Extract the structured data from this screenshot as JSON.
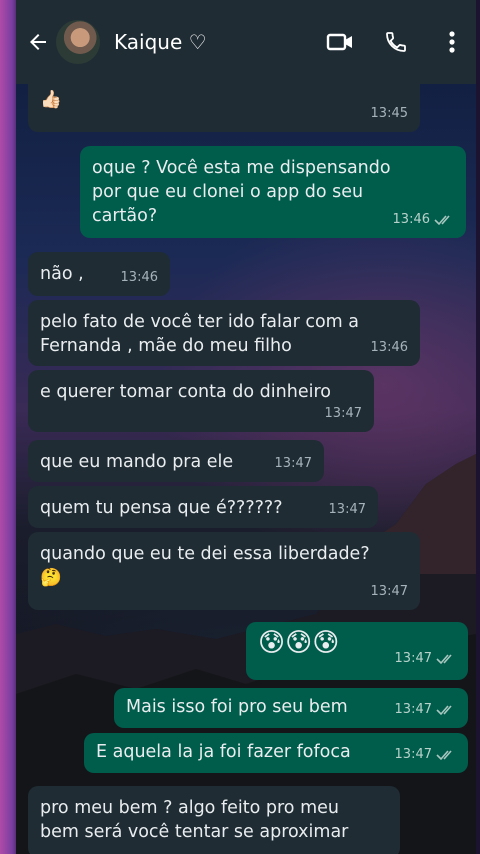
{
  "header": {
    "contact_name": "Kaique ♡"
  },
  "messages": [
    {
      "dir": "in",
      "text": "você , mais enfim nosso namoro acabou 👍🏻",
      "time": "13:45"
    },
    {
      "dir": "out",
      "text": "oque ? Você esta me dispensando por que eu clonei o app do seu cartão?",
      "time": "13:46"
    },
    {
      "dir": "in",
      "text": "não ,",
      "time": "13:46"
    },
    {
      "dir": "in",
      "text": "pelo fato de você ter ido falar com a Fernanda , mãe do meu filho",
      "time": "13:46"
    },
    {
      "dir": "in",
      "text": "e querer tomar conta do dinheiro",
      "time": "13:47"
    },
    {
      "dir": "in",
      "text": "que eu mando pra ele",
      "time": "13:47"
    },
    {
      "dir": "in",
      "text": "quem tu pensa que é??????",
      "time": "13:47"
    },
    {
      "dir": "in",
      "text": "quando que eu te dei essa liberdade? 🤔",
      "time": "13:47"
    },
    {
      "dir": "out",
      "text": "😰😰😰",
      "time": "13:47"
    },
    {
      "dir": "out",
      "text": "Mais isso foi pro seu bem",
      "time": "13:47"
    },
    {
      "dir": "out",
      "text": "E aquela la ja foi fazer fofoca",
      "time": "13:47"
    },
    {
      "dir": "in",
      "text": "pro meu bem ? algo feito pro meu bem será você tentar se aproximar",
      "time": ""
    }
  ],
  "colors": {
    "header_bg": "#1f2c34",
    "incoming_bubble": "#1f2c34",
    "outgoing_bubble": "#005c4b",
    "text": "#e9edef",
    "read_ticks": "#a7b3ba"
  },
  "icons": [
    "back-arrow-icon",
    "video-call-icon",
    "phone-icon",
    "more-vert-icon",
    "double-check-icon"
  ]
}
